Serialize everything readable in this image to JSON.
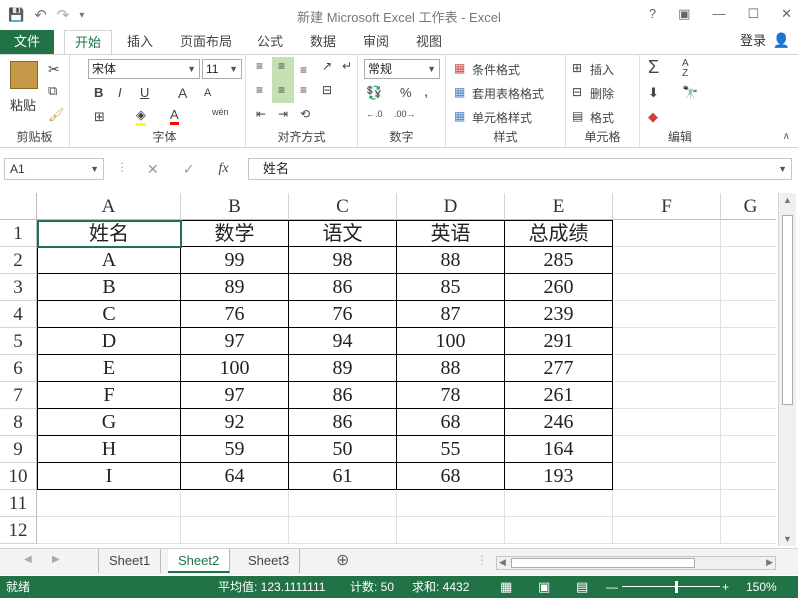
{
  "window": {
    "title": "新建 Microsoft Excel 工作表 - Excel",
    "help": "?",
    "ribbon_display": "▣",
    "minimize": "—",
    "maximize": "☐",
    "close": "✕"
  },
  "qat": {
    "save": "💾",
    "undo": "↶",
    "redo": "↷",
    "customize": "▾"
  },
  "tabs": {
    "file": "文件",
    "items": [
      "开始",
      "插入",
      "页面布局",
      "公式",
      "数据",
      "审阅",
      "视图"
    ],
    "login": "登录"
  },
  "ribbon": {
    "clipboard": {
      "paste": "粘贴",
      "label": "剪贴板"
    },
    "font": {
      "name": "宋体",
      "size": "11",
      "label": "字体",
      "bold": "B",
      "italic": "I",
      "underline": "U",
      "grow": "A",
      "shrink": "A",
      "phonetic": "wén"
    },
    "alignment": {
      "label": "对齐方式"
    },
    "number": {
      "format": "常规",
      "label": "数字",
      "percent": "%",
      "comma": ","
    },
    "styles": {
      "conditional": "条件格式",
      "table": "套用表格格式",
      "cell_styles": "单元格样式",
      "label": "样式"
    },
    "cells": {
      "insert": "插入",
      "delete": "删除",
      "format": "格式",
      "label": "单元格"
    },
    "editing": {
      "sum": "Σ",
      "sort": "A Z",
      "find": "🔭",
      "label": "编辑"
    }
  },
  "formula_bar": {
    "name_box": "A1",
    "cancel": "✕",
    "enter": "✓",
    "fx": "fx",
    "content": "姓名"
  },
  "sheet": {
    "columns": [
      "A",
      "B",
      "C",
      "D",
      "E",
      "F",
      "G"
    ],
    "rows": [
      "1",
      "2",
      "3",
      "4",
      "5",
      "6",
      "7",
      "8",
      "9",
      "10",
      "11",
      "12"
    ],
    "data": [
      [
        "姓名",
        "数学",
        "语文",
        "英语",
        "总成绩"
      ],
      [
        "A",
        "99",
        "98",
        "88",
        "285"
      ],
      [
        "B",
        "89",
        "86",
        "85",
        "260"
      ],
      [
        "C",
        "76",
        "76",
        "87",
        "239"
      ],
      [
        "D",
        "97",
        "94",
        "100",
        "291"
      ],
      [
        "E",
        "100",
        "89",
        "88",
        "277"
      ],
      [
        "F",
        "97",
        "86",
        "78",
        "261"
      ],
      [
        "G",
        "92",
        "86",
        "68",
        "246"
      ],
      [
        "H",
        "59",
        "50",
        "55",
        "164"
      ],
      [
        "I",
        "64",
        "61",
        "68",
        "193"
      ]
    ]
  },
  "sheet_tabs": [
    "Sheet1",
    "Sheet2",
    "Sheet3"
  ],
  "active_sheet": "Sheet2",
  "statusbar": {
    "ready": "就绪",
    "average": "平均值: 123.1111111",
    "count": "计数: 50",
    "sum": "求和: 4432",
    "zoom": "150%"
  },
  "colors": {
    "accent": "#217346"
  }
}
